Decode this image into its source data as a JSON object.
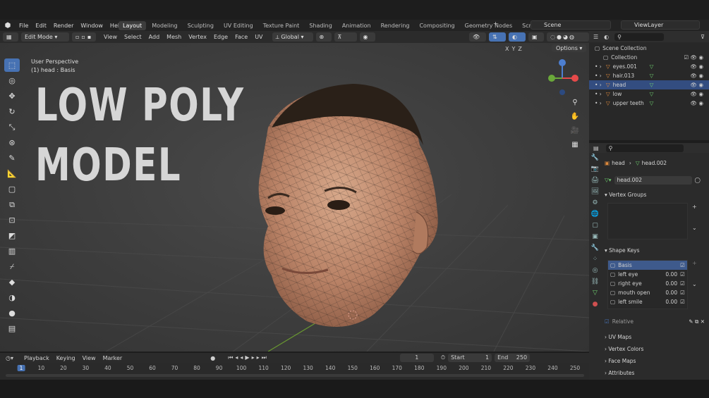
{
  "menu": [
    "File",
    "Edit",
    "Render",
    "Window",
    "Help"
  ],
  "workspace_tabs": [
    "Layout",
    "Modeling",
    "Sculpting",
    "UV Editing",
    "Texture Paint",
    "Shading",
    "Animation",
    "Rendering",
    "Compositing",
    "Geometry Nodes",
    "Scripting"
  ],
  "active_tab": "Layout",
  "scene": "Scene",
  "view_layer": "ViewLayer",
  "header": {
    "mode": "Edit Mode",
    "menus": [
      "View",
      "Select",
      "Add",
      "Mesh",
      "Vertex",
      "Edge",
      "Face",
      "UV"
    ],
    "orientation": "Global",
    "options": "Options",
    "axes": [
      "X",
      "Y",
      "Z"
    ]
  },
  "viewport": {
    "perspective": "User Perspective",
    "object_info": "(1) head : Basis",
    "title_line1": "LOW POLY",
    "title_line2": "MODEL"
  },
  "outliner": {
    "root": "Scene Collection",
    "collection": "Collection",
    "items": [
      "eyes.001",
      "hair.013",
      "head",
      "low",
      "upper teeth"
    ],
    "selected": "head"
  },
  "properties": {
    "object": "head",
    "mesh": "head.002",
    "mesh_field": "head.002",
    "vertex_groups": "Vertex Groups",
    "shape_keys_title": "Shape Keys",
    "shape_keys": [
      {
        "name": "Basis",
        "value": ""
      },
      {
        "name": "left eye",
        "value": "0.00"
      },
      {
        "name": "right eye",
        "value": "0.00"
      },
      {
        "name": "mouth open",
        "value": "0.00"
      },
      {
        "name": "left smile",
        "value": "0.00"
      }
    ],
    "relative": "Relative",
    "uv_maps": "UV Maps",
    "vertex_colors": "Vertex Colors",
    "face_maps": "Face Maps",
    "attributes": "Attributes"
  },
  "timeline": {
    "menus": [
      "Playback",
      "Keying",
      "View",
      "Marker"
    ],
    "current_frame": "1",
    "start_label": "Start",
    "start": "1",
    "end_label": "End",
    "end": "250",
    "ticks": [
      "1",
      "10",
      "20",
      "30",
      "40",
      "50",
      "60",
      "70",
      "80",
      "90",
      "100",
      "110",
      "120",
      "130",
      "140",
      "150",
      "160",
      "170",
      "180",
      "190",
      "200",
      "210",
      "220",
      "230",
      "240",
      "250"
    ]
  },
  "colors": {
    "accent": "#4772b3",
    "selected_row": "#334d80",
    "mesh_icon": "#e08a3c"
  }
}
